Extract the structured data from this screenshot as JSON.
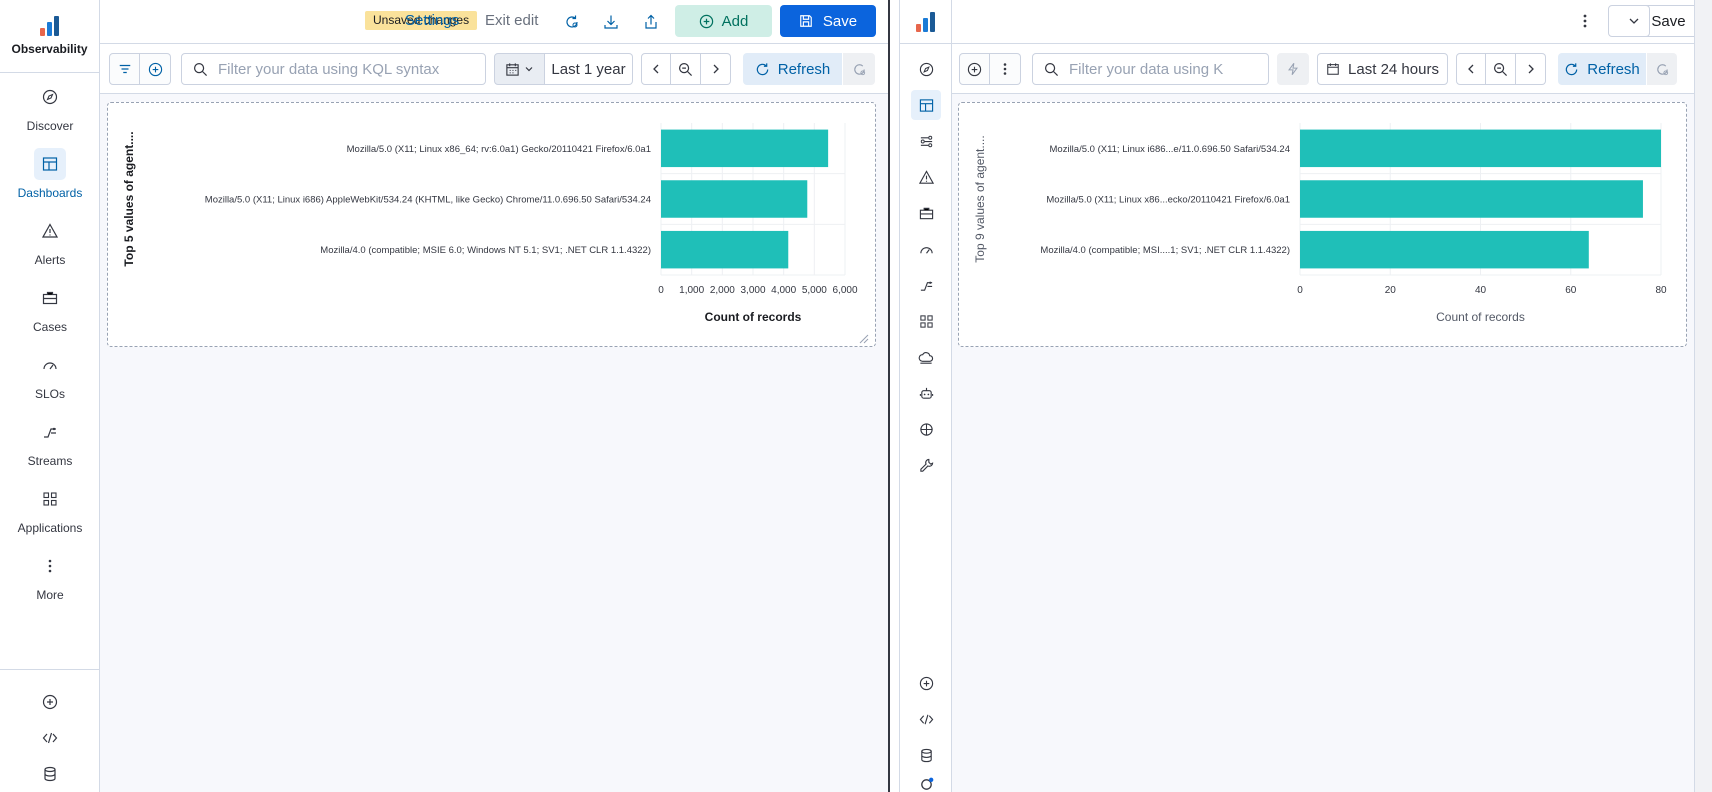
{
  "left": {
    "brand": {
      "label": "Observability"
    },
    "nav": [
      {
        "label": "Discover",
        "icon": "compass-icon"
      },
      {
        "label": "Dashboards",
        "icon": "dashboard-icon",
        "active": true
      },
      {
        "label": "Alerts",
        "icon": "warning-icon"
      },
      {
        "label": "Cases",
        "icon": "briefcase-icon"
      },
      {
        "label": "SLOs",
        "icon": "gauge-icon"
      },
      {
        "label": "Streams",
        "icon": "streams-icon"
      },
      {
        "label": "Applications",
        "icon": "apps-icon"
      },
      {
        "label": "More",
        "icon": "more-icon"
      }
    ],
    "topbar": {
      "unsaved": "Unsaved changes",
      "settings": "Settings",
      "exit_edit": "Exit edit",
      "add": "Add",
      "save": "Save"
    },
    "query": {
      "placeholder": "Filter your data using KQL syntax",
      "date": "Last 1 year",
      "refresh": "Refresh"
    }
  },
  "right": {
    "topbar": {
      "save": "Save"
    },
    "query": {
      "placeholder": "Filter your data using K",
      "date": "Last 24 hours",
      "refresh": "Refresh"
    }
  },
  "colors": {
    "bar": "#1fbfb8",
    "primary": "#0b64dd",
    "accent_bg": "#e1ecf8"
  },
  "chart_data": [
    {
      "type": "bar",
      "orientation": "horizontal",
      "categories": [
        "Mozilla/5.0 (X11; Linux x86_64; rv:6.0a1) Gecko/20110421 Firefox/6.0a1",
        "Mozilla/5.0 (X11; Linux i686) AppleWebKit/534.24 (KHTML, like Gecko) Chrome/11.0.696.50 Safari/534.24",
        "Mozilla/4.0 (compatible; MSIE 6.0; Windows NT 5.1; SV1; .NET CLR 1.1.4322)"
      ],
      "values": [
        5450,
        4770,
        4150
      ],
      "xlabel": "Count of records",
      "ylabel": "Top 5 values of agent....",
      "xlim": [
        0,
        6000
      ],
      "ticks": [
        "0",
        "1,000",
        "2,000",
        "3,000",
        "4,000",
        "5,000",
        "6,000"
      ],
      "tick_values": [
        0,
        1000,
        2000,
        3000,
        4000,
        5000,
        6000
      ]
    },
    {
      "type": "bar",
      "orientation": "horizontal",
      "categories": [
        "Mozilla/5.0 (X11; Linux i686...e/11.0.696.50 Safari/534.24",
        "Mozilla/5.0 (X11; Linux x86...ecko/20110421 Firefox/6.0a1",
        "Mozilla/4.0 (compatible; MSI....1; SV1; .NET CLR 1.1.4322)"
      ],
      "values": [
        80,
        76,
        64
      ],
      "xlabel": "Count of records",
      "ylabel": "Top 9 values of agent....",
      "xlim": [
        0,
        80
      ],
      "ticks": [
        "0",
        "20",
        "40",
        "60",
        "80"
      ],
      "tick_values": [
        0,
        20,
        40,
        60,
        80
      ]
    }
  ]
}
